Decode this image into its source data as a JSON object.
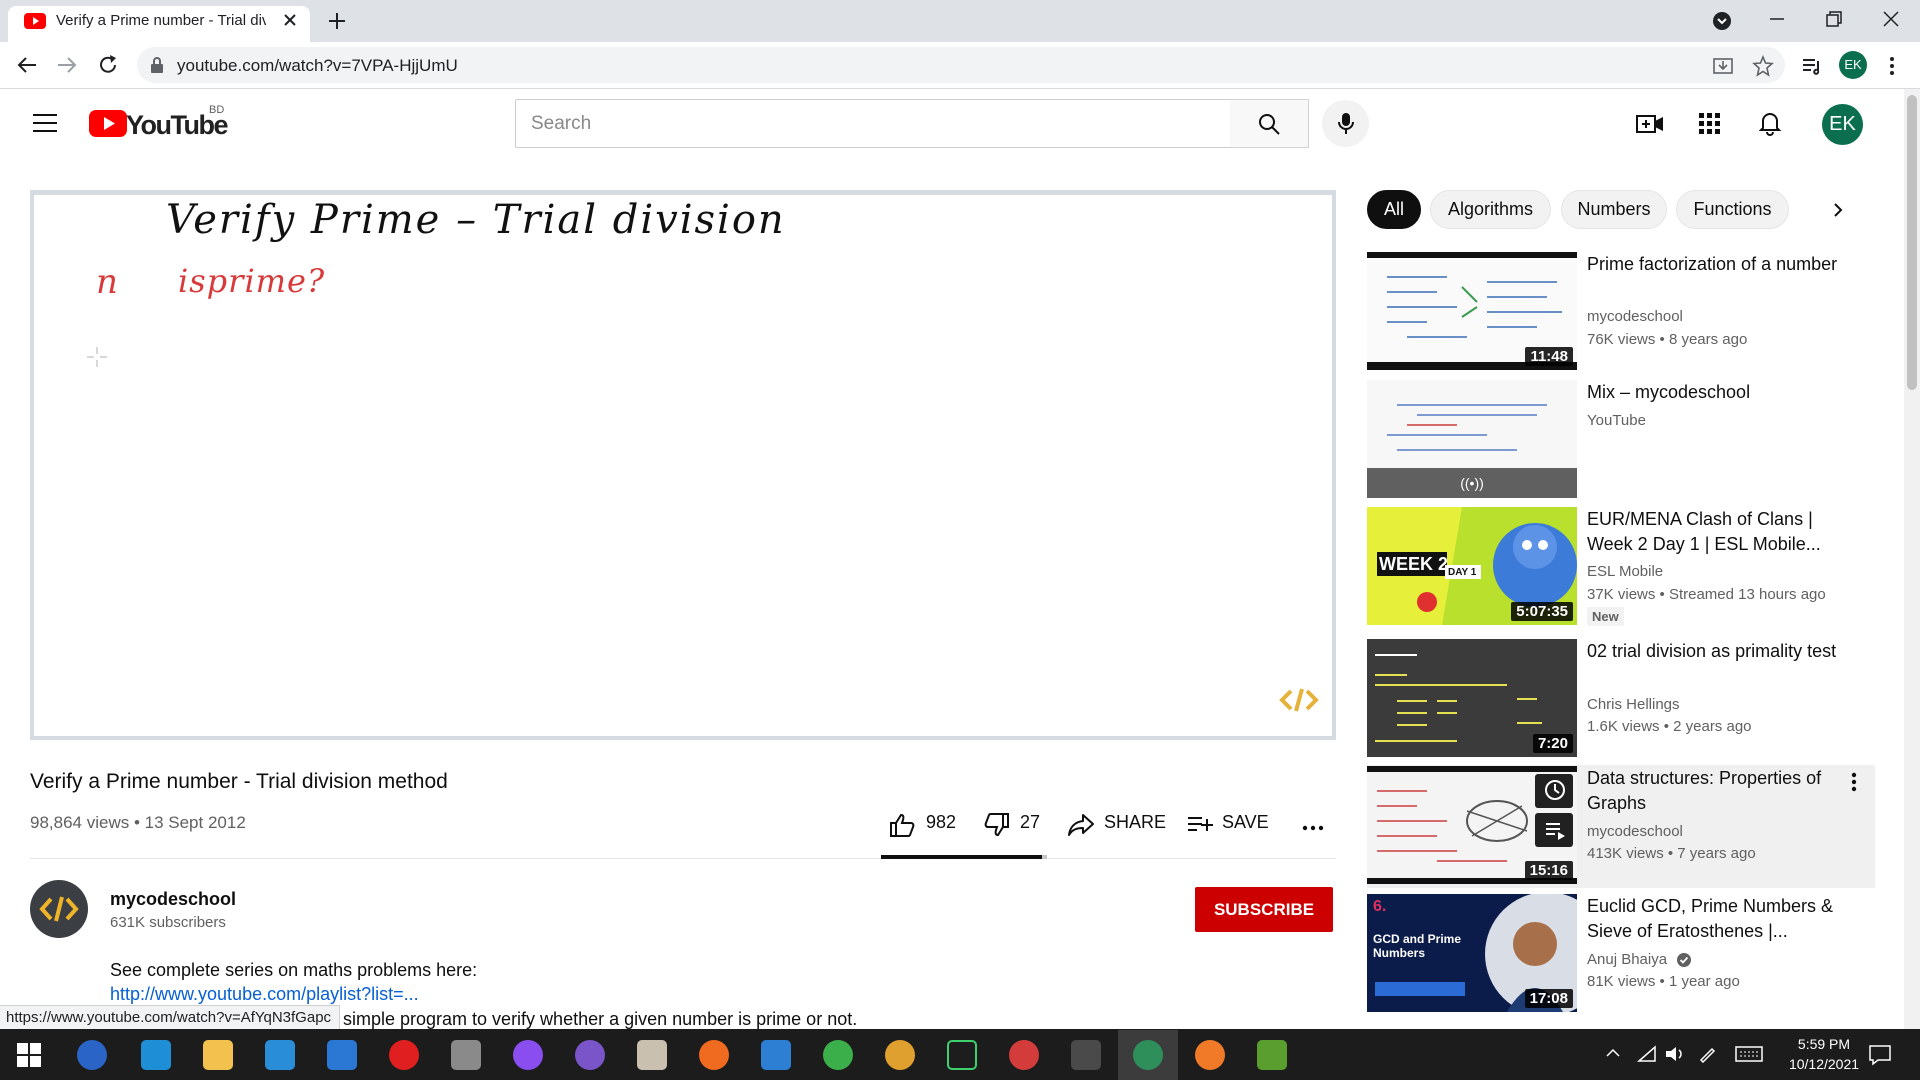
{
  "browser": {
    "tab_title": "Verify a Prime number - Trial divi",
    "url": "youtube.com/watch?v=7VPA-HjjUmU",
    "profile_initials": "EK",
    "status_url": "https://www.youtube.com/watch?v=AfYqN3fGapc"
  },
  "header": {
    "logo_text": "YouTube",
    "country": "BD",
    "search_placeholder": "Search",
    "avatar_initials": "EK"
  },
  "player": {
    "board_title": "Verify Prime – Trial division",
    "board_n": "n",
    "board_isprime": "isprime?"
  },
  "video": {
    "title": "Verify a Prime number - Trial division method",
    "meta": "98,864 views • 13 Sept 2012",
    "likes": "982",
    "dislikes": "27",
    "share_label": "SHARE",
    "save_label": "SAVE",
    "like_ratio": 0.97
  },
  "channel": {
    "name": "mycodeschool",
    "subscribers": "631K subscribers",
    "subscribe_label": "SUBSCRIBE"
  },
  "description": {
    "line1": "See complete series on maths problems here:",
    "link": "http://www.youtube.com/playlist?list=...",
    "line3": "simple program to verify whether a given number is prime or not."
  },
  "chips": [
    "All",
    "Algorithms",
    "Numbers",
    "Functions"
  ],
  "recommendations": [
    {
      "title": "Prime factorization of a number",
      "channel": "mycodeschool",
      "stats": "76K views • 8 years ago",
      "duration": "11:48"
    },
    {
      "title": "Mix – mycodeschool",
      "channel": "YouTube",
      "stats": "",
      "duration": "((•))"
    },
    {
      "title": "EUR/MENA Clash of Clans | Week 2 Day 1 | ESL Mobile...",
      "channel": "ESL Mobile",
      "stats": "37K views • Streamed 13 hours ago",
      "duration": "5:07:35",
      "badge": "New"
    },
    {
      "title": "02 trial division as primality test",
      "channel": "Chris Hellings",
      "stats": "1.6K views • 2 years ago",
      "duration": "7:20"
    },
    {
      "title": "Data structures: Properties of Graphs",
      "channel": "mycodeschool",
      "stats": "413K views • 7 years ago",
      "duration": "15:16"
    },
    {
      "title": "Euclid GCD, Prime Numbers & Sieve of Eratosthenes |...",
      "channel": "Anuj Bhaiya",
      "stats": "81K views • 1 year ago",
      "duration": "17:08"
    }
  ],
  "thumb_text": {
    "week": "WEEK 2",
    "day": "DAY 1",
    "gcd": "GCD and Prime Numbers",
    "num": "6."
  },
  "taskbar": {
    "time": "5:59 PM",
    "date": "10/12/2021"
  },
  "colors": {
    "brand_red": "#ff0000",
    "subscribe_red": "#cc0000",
    "link_blue": "#065fd4",
    "avatar_green": "#0b6e4f"
  }
}
